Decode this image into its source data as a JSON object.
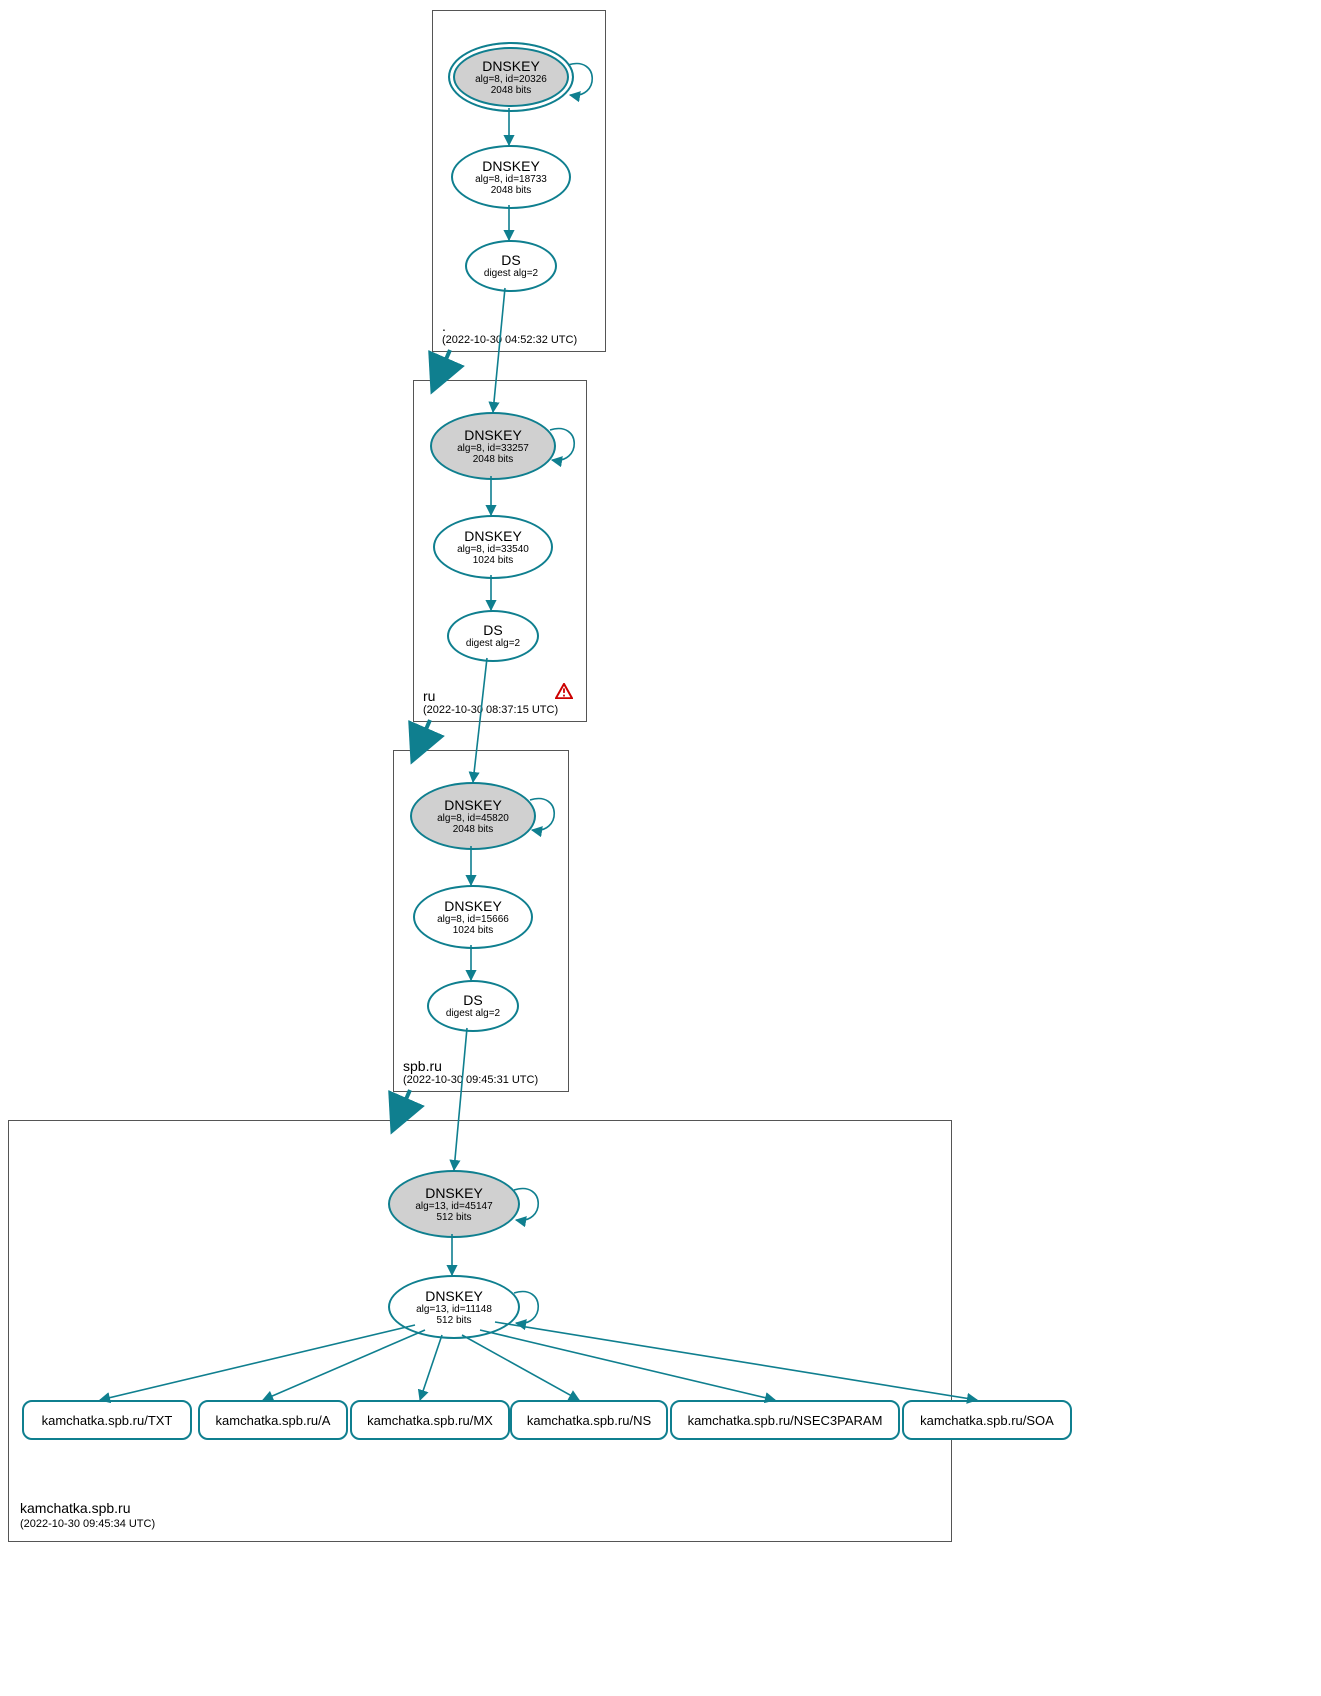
{
  "zones": {
    "root": {
      "label": ".",
      "time": "(2022-10-30 04:52:32 UTC)"
    },
    "ru": {
      "label": "ru",
      "time": "(2022-10-30 08:37:15 UTC)",
      "warning": true
    },
    "spbru": {
      "label": "spb.ru",
      "time": "(2022-10-30 09:45:31 UTC)"
    },
    "kamchatka": {
      "label": "kamchatka.spb.ru",
      "time": "(2022-10-30 09:45:34 UTC)"
    }
  },
  "nodes": {
    "root_ksk": {
      "title": "DNSKEY",
      "line1": "alg=8, id=20326",
      "line2": "2048 bits"
    },
    "root_zsk": {
      "title": "DNSKEY",
      "line1": "alg=8, id=18733",
      "line2": "2048 bits"
    },
    "root_ds": {
      "title": "DS",
      "line1": "digest alg=2",
      "line2": ""
    },
    "ru_ksk": {
      "title": "DNSKEY",
      "line1": "alg=8, id=33257",
      "line2": "2048 bits"
    },
    "ru_zsk": {
      "title": "DNSKEY",
      "line1": "alg=8, id=33540",
      "line2": "1024 bits"
    },
    "ru_ds": {
      "title": "DS",
      "line1": "digest alg=2",
      "line2": ""
    },
    "spb_ksk": {
      "title": "DNSKEY",
      "line1": "alg=8, id=45820",
      "line2": "2048 bits"
    },
    "spb_zsk": {
      "title": "DNSKEY",
      "line1": "alg=8, id=15666",
      "line2": "1024 bits"
    },
    "spb_ds": {
      "title": "DS",
      "line1": "digest alg=2",
      "line2": ""
    },
    "kam_ksk": {
      "title": "DNSKEY",
      "line1": "alg=13, id=45147",
      "line2": "512 bits"
    },
    "kam_zsk": {
      "title": "DNSKEY",
      "line1": "alg=13, id=11148",
      "line2": "512 bits"
    }
  },
  "rrsets": {
    "txt": "kamchatka.spb.ru/TXT",
    "a": "kamchatka.spb.ru/A",
    "mx": "kamchatka.spb.ru/MX",
    "ns": "kamchatka.spb.ru/NS",
    "nsec3": "kamchatka.spb.ru/NSEC3PARAM",
    "soa": "kamchatka.spb.ru/SOA"
  }
}
